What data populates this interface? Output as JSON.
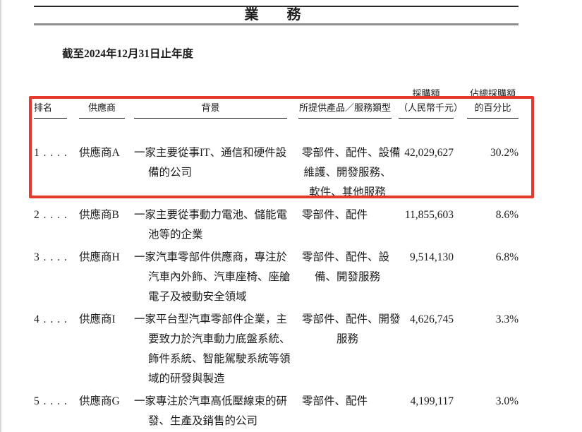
{
  "page": {
    "section_title": "業　務",
    "period": "截至2024年12月31日止年度"
  },
  "table": {
    "highlight_color": "#e8372c",
    "headers": {
      "rank": "排名",
      "supplier": "供應商",
      "background": "背景",
      "products": "所提供產品／服務類型",
      "amount_line1": "採購額",
      "amount_line2": "（人民幣千元）",
      "pct_line1": "佔總採購額",
      "pct_line2": "的百分比"
    },
    "rows": [
      {
        "rank": "1 . . . .",
        "supplier": "供應商A",
        "background_lines": [
          "一家主要從事IT、通信和硬件設",
          "備的公司"
        ],
        "products_lines": [
          "零部件、配件、設備",
          "維護、開發服務、",
          "軟件、其他服務"
        ],
        "amount": "42,029,627",
        "pct": "30.2%",
        "highlighted": true
      },
      {
        "rank": "2 . . . .",
        "supplier": "供應商B",
        "background_lines": [
          "一家主要從事動力電池、儲能電",
          "池等的企業"
        ],
        "products_lines": [
          "零部件、配件"
        ],
        "amount": "11,855,603",
        "pct": "8.6%",
        "highlighted": false
      },
      {
        "rank": "3 . . . .",
        "supplier": "供應商H",
        "background_lines": [
          "一家汽車零部件供應商，專注於",
          "汽車內外飾、汽車座椅、座艙",
          "電子及被動安全領域"
        ],
        "products_lines": [
          "零部件、配件、設",
          "備、開發服務"
        ],
        "amount": "9,514,130",
        "pct": "6.8%",
        "highlighted": false
      },
      {
        "rank": "4 . . . .",
        "supplier": "供應商I",
        "background_lines": [
          "一家平台型汽車零部件企業，主",
          "要致力於汽車動力底盤系統、",
          "飾件系統、智能駕駛系統等領",
          "域的研發與製造"
        ],
        "products_lines": [
          "零部件、配件、開發",
          "服務"
        ],
        "amount": "4,626,745",
        "pct": "3.3%",
        "highlighted": false
      },
      {
        "rank": "5 . . . .",
        "supplier": "供應商G",
        "background_lines": [
          "一家專注於汽車高低壓線束的研",
          "發、生產及銷售的公司"
        ],
        "products_lines": [
          "零部件、配件"
        ],
        "amount": "4,199,117",
        "pct": "3.0%",
        "highlighted": false
      }
    ]
  }
}
